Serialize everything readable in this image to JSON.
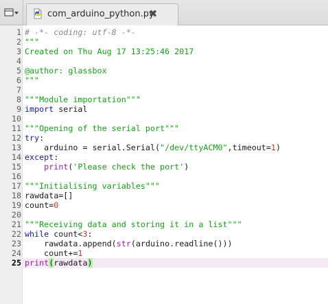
{
  "tabbar": {
    "tab_title": "com_arduino_python.py",
    "close_glyph": "✖",
    "list_icon": "tab-list-icon",
    "file_icon": "python-file-icon"
  },
  "colors": {
    "comment": "#8a8a8a",
    "string": "#14a314",
    "keyword": "#1a1aa6",
    "builtin": "#9c1ea3",
    "number": "#d43434",
    "current_line": "#f4e9f5",
    "bracket_match": "#b3f2a7"
  },
  "editor": {
    "current_line": 25,
    "lines": [
      {
        "n": "1",
        "tokens": [
          {
            "t": "# -*- coding: utf-8 -*-",
            "c": "comment"
          }
        ]
      },
      {
        "n": "2",
        "tokens": [
          {
            "t": "\"\"\"",
            "c": "string"
          }
        ]
      },
      {
        "n": "3",
        "tokens": [
          {
            "t": "Created on Thu Aug 17 13:25:46 2017",
            "c": "string"
          }
        ]
      },
      {
        "n": "4",
        "tokens": []
      },
      {
        "n": "5",
        "tokens": [
          {
            "t": "@author: glassbox",
            "c": "string"
          }
        ]
      },
      {
        "n": "6",
        "tokens": [
          {
            "t": "\"\"\"",
            "c": "string"
          }
        ]
      },
      {
        "n": "7",
        "tokens": []
      },
      {
        "n": "8",
        "tokens": [
          {
            "t": "\"\"\"Module importation\"\"\"",
            "c": "string"
          }
        ]
      },
      {
        "n": "9",
        "tokens": [
          {
            "t": "import",
            "c": "keyword"
          },
          {
            "t": " serial",
            "c": "default"
          }
        ]
      },
      {
        "n": "10",
        "tokens": []
      },
      {
        "n": "11",
        "tokens": [
          {
            "t": "\"\"\"Opening of the serial port\"\"\"",
            "c": "string"
          }
        ]
      },
      {
        "n": "12",
        "tokens": [
          {
            "t": "try",
            "c": "keyword"
          },
          {
            "t": ":",
            "c": "default"
          }
        ]
      },
      {
        "n": "13",
        "tokens": [
          {
            "t": "    arduino = serial.Serial(",
            "c": "default"
          },
          {
            "t": "\"/dev/ttyACM0\"",
            "c": "string"
          },
          {
            "t": ",timeout=",
            "c": "default"
          },
          {
            "t": "1",
            "c": "number"
          },
          {
            "t": ")",
            "c": "default"
          }
        ]
      },
      {
        "n": "14",
        "tokens": [
          {
            "t": "except",
            "c": "keyword"
          },
          {
            "t": ":",
            "c": "default"
          }
        ]
      },
      {
        "n": "15",
        "tokens": [
          {
            "t": "    ",
            "c": "default"
          },
          {
            "t": "print",
            "c": "builtin"
          },
          {
            "t": "(",
            "c": "default"
          },
          {
            "t": "'Please check the port'",
            "c": "string"
          },
          {
            "t": ")",
            "c": "default"
          }
        ]
      },
      {
        "n": "16",
        "tokens": []
      },
      {
        "n": "17",
        "tokens": [
          {
            "t": "\"\"\"Initialising variables\"\"\"",
            "c": "string"
          }
        ]
      },
      {
        "n": "18",
        "tokens": [
          {
            "t": "rawdata=[]",
            "c": "default"
          }
        ]
      },
      {
        "n": "19",
        "tokens": [
          {
            "t": "count=",
            "c": "default"
          },
          {
            "t": "0",
            "c": "number"
          }
        ]
      },
      {
        "n": "20",
        "tokens": []
      },
      {
        "n": "21",
        "tokens": [
          {
            "t": "\"\"\"Receiving data and storing it in a list\"\"\"",
            "c": "string"
          }
        ]
      },
      {
        "n": "22",
        "tokens": [
          {
            "t": "while",
            "c": "keyword"
          },
          {
            "t": " count<",
            "c": "default"
          },
          {
            "t": "3",
            "c": "number"
          },
          {
            "t": ":",
            "c": "default"
          }
        ]
      },
      {
        "n": "23",
        "tokens": [
          {
            "t": "    rawdata.append(",
            "c": "default"
          },
          {
            "t": "str",
            "c": "builtin"
          },
          {
            "t": "(arduino.readline()))",
            "c": "default"
          }
        ]
      },
      {
        "n": "24",
        "tokens": [
          {
            "t": "    count+=",
            "c": "default"
          },
          {
            "t": "1",
            "c": "number"
          }
        ]
      },
      {
        "n": "25",
        "tokens": [
          {
            "t": "print",
            "c": "builtin"
          },
          {
            "t": "(",
            "c": "bracket-match"
          },
          {
            "t": "rawdata",
            "c": "default"
          },
          {
            "t": ")",
            "c": "bracket-match"
          }
        ]
      }
    ]
  }
}
